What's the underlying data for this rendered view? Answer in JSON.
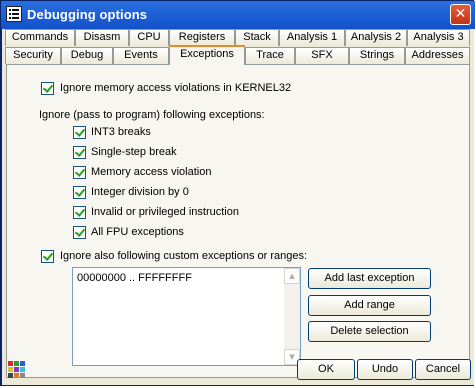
{
  "window": {
    "title": "Debugging options",
    "close_glyph": "✕"
  },
  "tabs_row1": [
    {
      "label": "Commands"
    },
    {
      "label": "Disasm"
    },
    {
      "label": "CPU"
    },
    {
      "label": "Registers"
    },
    {
      "label": "Stack"
    },
    {
      "label": "Analysis 1"
    },
    {
      "label": "Analysis 2"
    },
    {
      "label": "Analysis 3"
    }
  ],
  "tabs_row2": [
    {
      "label": "Security"
    },
    {
      "label": "Debug"
    },
    {
      "label": "Events"
    },
    {
      "label": "Exceptions",
      "active": true
    },
    {
      "label": "Trace"
    },
    {
      "label": "SFX"
    },
    {
      "label": "Strings"
    },
    {
      "label": "Addresses"
    }
  ],
  "exceptions": {
    "ignore_kernel32": {
      "label": "Ignore memory access violations in KERNEL32",
      "checked": true
    },
    "ignore_group_label": "Ignore (pass to program) following exceptions:",
    "items": [
      {
        "label": "INT3 breaks",
        "checked": true
      },
      {
        "label": "Single-step break",
        "checked": true
      },
      {
        "label": "Memory access violation",
        "checked": true
      },
      {
        "label": "Integer division by 0",
        "checked": true
      },
      {
        "label": "Invalid or privileged instruction",
        "checked": true
      },
      {
        "label": "All FPU exceptions",
        "checked": true
      }
    ],
    "custom": {
      "label": "Ignore also following custom exceptions or ranges:",
      "checked": true
    },
    "ranges": [
      "00000000 .. FFFFFFFF"
    ],
    "buttons": {
      "add_last": "Add last exception",
      "add_range": "Add range",
      "delete_selection": "Delete selection"
    }
  },
  "footer": {
    "ok": "OK",
    "undo": "Undo",
    "cancel": "Cancel"
  },
  "colors": {
    "title_bar": "#1251c9",
    "active_tab_accent": "#e68b2c",
    "dialog_bg": "#ece9d8",
    "check": "#21a121"
  }
}
